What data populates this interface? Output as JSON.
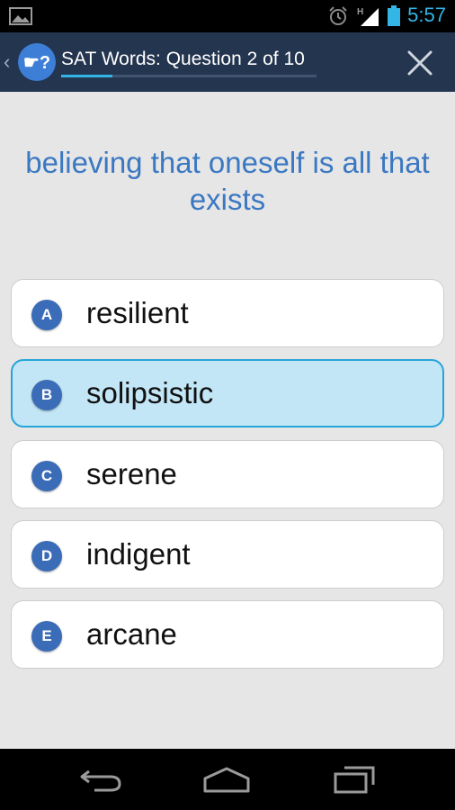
{
  "status_bar": {
    "time": "5:57",
    "network": "H",
    "icons": [
      "picture-icon",
      "alarm-icon",
      "signal-icon",
      "battery-icon"
    ]
  },
  "action_bar": {
    "title": "SAT Words: Question 2 of 10",
    "logo_text": "☛?",
    "up_chevron": "‹",
    "progress": 0.2,
    "icons": [
      "app-logo-icon",
      "close-icon"
    ]
  },
  "question": {
    "text": "believing that oneself is all that exists"
  },
  "answers": [
    {
      "letter": "A",
      "word": "resilient",
      "selected": false
    },
    {
      "letter": "B",
      "word": "solipsistic",
      "selected": true
    },
    {
      "letter": "C",
      "word": "serene",
      "selected": false
    },
    {
      "letter": "D",
      "word": "indigent",
      "selected": false
    },
    {
      "letter": "E",
      "word": "arcane",
      "selected": false
    }
  ],
  "nav_bar": {
    "icons": [
      "back-icon",
      "home-icon",
      "recents-icon"
    ]
  },
  "colors": {
    "action_bar_bg": "#24354f",
    "accent": "#33b5e5",
    "question_text": "#3a78c2",
    "letter_badge": "#3b6cb7",
    "selected_bg": "#c2e6f6",
    "selected_border": "#26a4d8",
    "content_bg": "#e6e6e6"
  }
}
